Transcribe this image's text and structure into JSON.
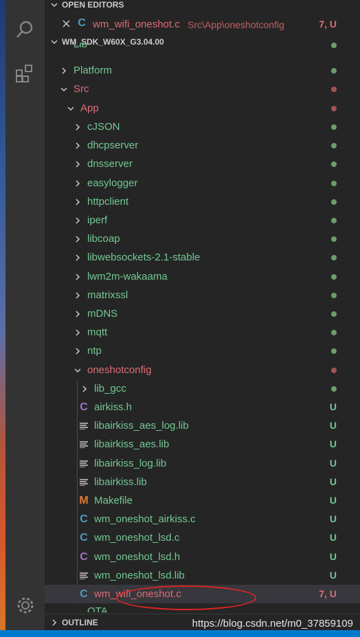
{
  "sections": {
    "open_editors": "OPEN EDITORS",
    "workspace": "WM_SDK_W60X_G3.04.00",
    "outline": "OUTLINE"
  },
  "open_editor": {
    "file": "wm_wifi_oneshot.c",
    "path": "Src\\App\\oneshotconfig",
    "status": "7, U"
  },
  "tree": {
    "lib": "Lib",
    "platform": "Platform",
    "src": "Src",
    "app": "App",
    "folders": [
      "cJSON",
      "dhcpserver",
      "dnsserver",
      "easylogger",
      "httpclient",
      "iperf",
      "libcoap",
      "libwebsockets-2.1-stable",
      "lwm2m-wakaama",
      "matrixssl",
      "mDNS",
      "mqtt",
      "ntp"
    ],
    "oneshotconfig": "oneshotconfig",
    "lib_gcc": "lib_gcc",
    "files": [
      {
        "name": "airkiss.h",
        "status": "U"
      },
      {
        "name": "libairkiss_aes_log.lib",
        "status": "U"
      },
      {
        "name": "libairkiss_aes.lib",
        "status": "U"
      },
      {
        "name": "libairkiss_log.lib",
        "status": "U"
      },
      {
        "name": "libairkiss.lib",
        "status": "U"
      },
      {
        "name": "Makefile",
        "status": "U"
      },
      {
        "name": "wm_oneshot_airkiss.c",
        "status": "U"
      },
      {
        "name": "wm_oneshot_lsd.c",
        "status": "U"
      },
      {
        "name": "wm_oneshot_lsd.h",
        "status": "U"
      },
      {
        "name": "wm_oneshot_lsd.lib",
        "status": "U"
      },
      {
        "name": "wm_wifi_oneshot.c",
        "status": "7, U"
      }
    ],
    "partial_below": "OTA"
  },
  "icons": {
    "c_file": "C",
    "h_file": "C",
    "makefile": "M"
  },
  "colors": {
    "untracked": "#73c991",
    "modified": "#e06c75",
    "accent": "#007acc"
  },
  "watermark": "https://blog.csdn.net/m0_37859109"
}
